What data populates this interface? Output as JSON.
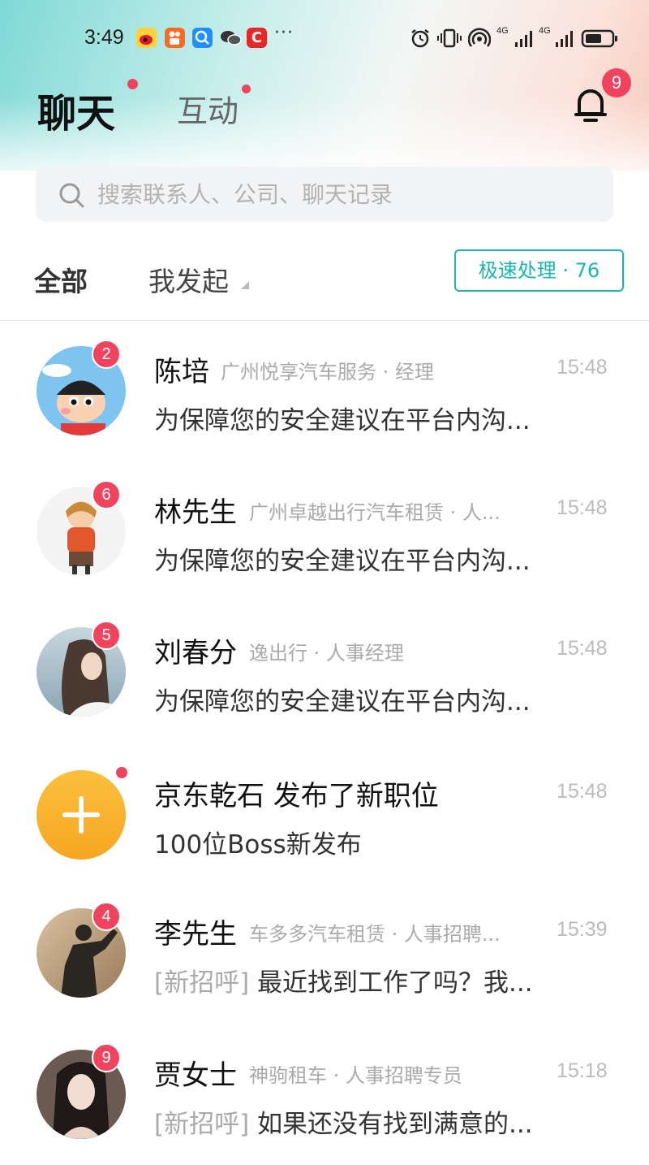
{
  "colors": {
    "accent": "#1ab6b2",
    "badge": "#f0445e",
    "orange": "#f7b731"
  },
  "status_bar": {
    "time": "3:49",
    "notif_icons": [
      "weibo-icon",
      "kuaishou-icon",
      "search-app-icon",
      "wechat-icon",
      "c-app-icon"
    ],
    "more": "···",
    "net_1": "4G",
    "net_2": "4G"
  },
  "header": {
    "tab_chat": "聊天",
    "tab_interact": "互动",
    "bell_count": "9"
  },
  "search": {
    "placeholder": "搜索联系人、公司、聊天记录"
  },
  "filters": {
    "all": "全部",
    "mine": "我发起",
    "quick_label": "极速处理 · 76"
  },
  "chats": [
    {
      "name": "陈培",
      "company": "广州悦享汽车服务 · 经理",
      "time": "15:48",
      "tag": "",
      "message": "为保障您的安全建议在平台内沟...",
      "badge": "2"
    },
    {
      "name": "林先生",
      "company": "广州卓越出行汽车租赁 · 人...",
      "time": "15:48",
      "tag": "",
      "message": "为保障您的安全建议在平台内沟...",
      "badge": "6"
    },
    {
      "name": "刘春分",
      "company": "逸出行 · 人事经理",
      "time": "15:48",
      "tag": "",
      "message": "为保障您的安全建议在平台内沟...",
      "badge": "5"
    },
    {
      "name": "京东乾石 发布了新职位",
      "company": "",
      "time": "15:48",
      "tag": "",
      "message": "100位Boss新发布",
      "badge": ""
    },
    {
      "name": "李先生",
      "company": "车多多汽车租赁 · 人事招聘...",
      "time": "15:39",
      "tag": "[新招呼]",
      "message": "最近找到工作了吗？我...",
      "badge": "4"
    },
    {
      "name": "贾女士",
      "company": "神驹租车 · 人事招聘专员",
      "time": "15:18",
      "tag": "[新招呼]",
      "message": "如果还没有找到满意的...",
      "badge": "9"
    }
  ]
}
